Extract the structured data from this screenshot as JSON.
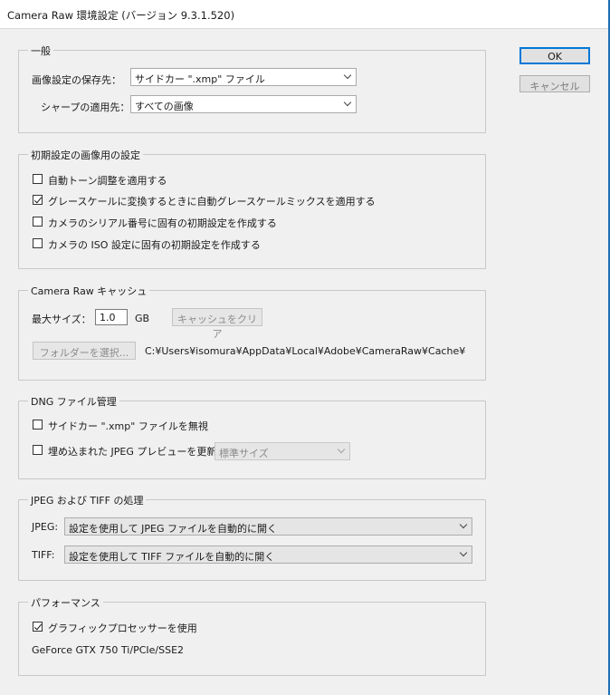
{
  "window": {
    "title": "Camera Raw 環境設定 (バージョン 9.3.1.520)"
  },
  "buttons": {
    "ok": "OK",
    "cancel": "キャンセル"
  },
  "general": {
    "legend": "一般",
    "save_label": "画像設定の保存先：",
    "save_value": "サイドカー \".xmp\" ファイル",
    "sharpen_label": "シャープの適用先：",
    "sharpen_value": "すべての画像"
  },
  "defaults": {
    "legend": "初期設定の画像用の設定",
    "items": [
      {
        "label": "自動トーン調整を適用する",
        "checked": false
      },
      {
        "label": "グレースケールに変換するときに自動グレースケールミックスを適用する",
        "checked": true
      },
      {
        "label": "カメラのシリアル番号に固有の初期設定を作成する",
        "checked": false
      },
      {
        "label": "カメラの ISO 設定に固有の初期設定を作成する",
        "checked": false
      }
    ]
  },
  "cache": {
    "legend": "Camera Raw キャッシュ",
    "max_label": "最大サイズ：",
    "max_value": "1.0",
    "unit": "GB",
    "clear_button": "キャッシュをクリア",
    "folder_button": "フォルダーを選択...",
    "path": "C:¥Users¥isomura¥AppData¥Local¥Adobe¥CameraRaw¥Cache¥"
  },
  "dng": {
    "legend": "DNG ファイル管理",
    "ignore_label": "サイドカー \".xmp\" ファイルを無視",
    "ignore_checked": false,
    "update_label": "埋め込まれた JPEG プレビューを更新：",
    "update_checked": false,
    "preview_value": "標準サイズ"
  },
  "jpeg_tiff": {
    "legend": "JPEG および TIFF の処理",
    "jpeg_label": "JPEG:",
    "jpeg_value": "設定を使用して JPEG ファイルを自動的に開く",
    "tiff_label": "TIFF:",
    "tiff_value": "設定を使用して TIFF ファイルを自動的に開く"
  },
  "performance": {
    "legend": "パフォーマンス",
    "gpu_label": "グラフィックプロセッサーを使用",
    "gpu_checked": true,
    "gpu_name": "GeForce GTX 750 Ti/PCIe/SSE2"
  }
}
